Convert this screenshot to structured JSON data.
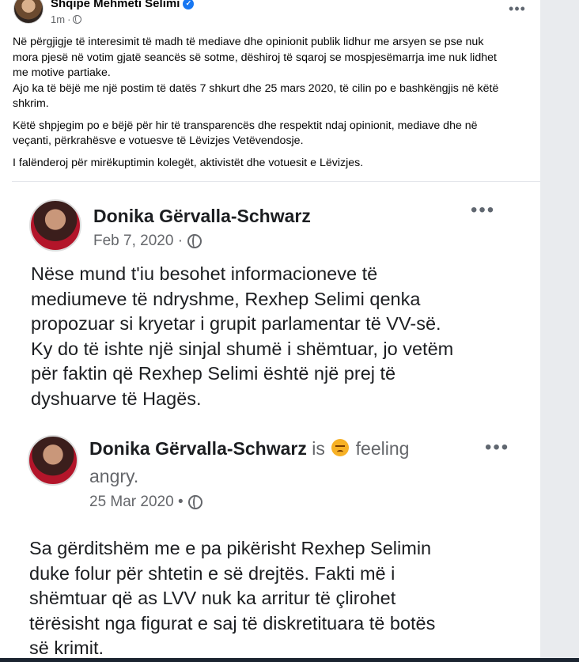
{
  "post": {
    "author": "Shqipe Mehmeti Selimi",
    "time": "1m",
    "more": "•••",
    "paragraphs": [
      "Në përgjigje të interesimit të madh të mediave dhe opinionit publik lidhur me arsyen se pse nuk\nmora pjesë në votim gjatë seancës së sotme, dëshiroj të sqaroj se mospjesëmarrja ime nuk lidhet\nme motive partiake.\nAjo ka të bëjë me një postim të datës 7 shkurt dhe 25 mars 2020, të cilin po e bashkëngjis në këtë\nshkrim.",
      "Këtë shpjegim po e bëjë për hir të transparencës dhe respektit ndaj opinionit, mediave dhe në\nveçanti, përkrahësve e votuesve të Lëvizjes Vetëvendosje.",
      "I falënderoj për mirëkuptimin kolegët, aktivistët dhe votuesit e Lëvizjes."
    ]
  },
  "attachment": {
    "first": {
      "name": "Donika Gërvalla-Schwarz",
      "date": "Feb 7, 2020 ·",
      "more": "•••",
      "text": "Nëse mund t'iu besohet informacioneve të\nmediumeve të ndryshme, Rexhep Selimi qenka\npropozuar si kryetar i grupit parlamentar të VV-së.\nKy do të ishte një sinjal shumë i shëmtuar, jo vetëm\npër faktin që Rexhep Selimi është një prej të\ndyshuarve të Hagës."
    },
    "second": {
      "name": "Donika Gërvalla-Schwarz",
      "is": "is",
      "feeling": "feeling",
      "feeling_word": "angry.",
      "date": "25 Mar 2020 •",
      "more": "•••",
      "text": "Sa gërditshëm me e pa pikërisht Rexhep Selimin\nduke folur për shtetin e së drejtës. Fakti më i\nshëmtuar që as LVV nuk ka arritur të çlirohet\ntërësisht nga figurat e saj të diskretituara të botës\nsë krimit."
    }
  },
  "colors": {
    "verified": "#1877f2",
    "secondary_text": "#65676b",
    "angry_emoji": "#f7b125"
  },
  "icons": [
    "verified-badge-icon",
    "globe-icon",
    "more-options-icon",
    "angry-emoji-icon"
  ]
}
